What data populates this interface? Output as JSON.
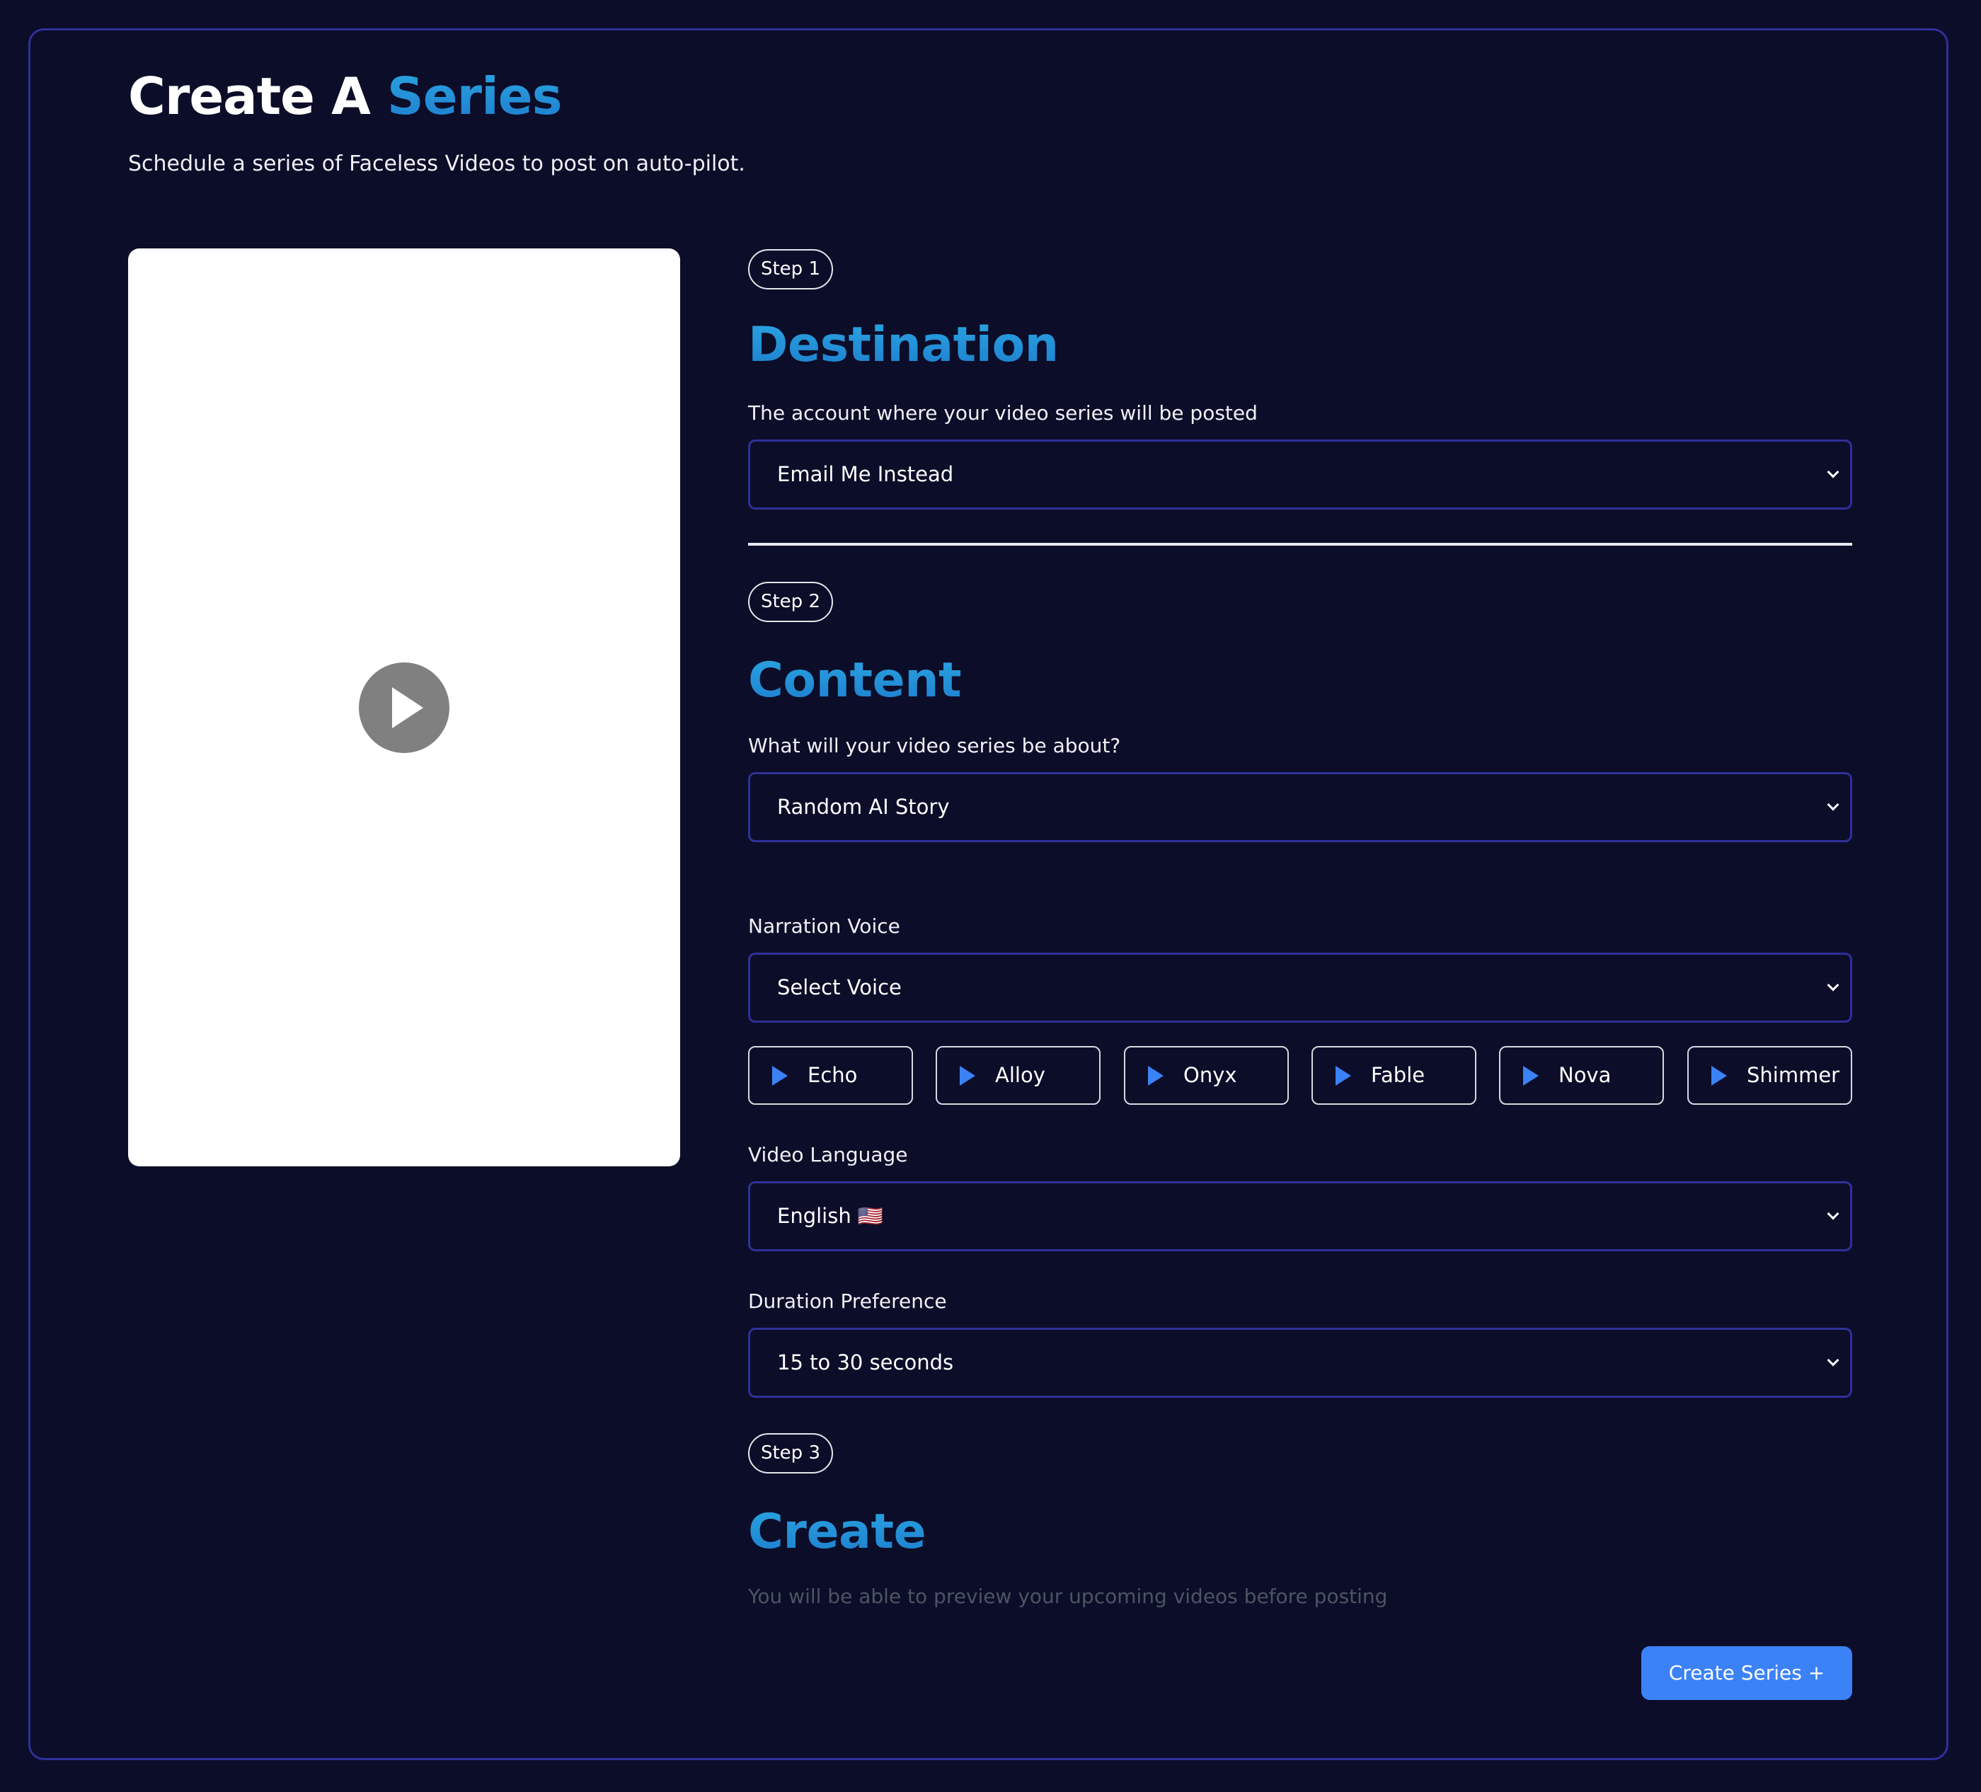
{
  "header": {
    "title_prefix": "Create A ",
    "title_highlight": "Series",
    "subtitle": "Schedule a series of Faceless Videos to post on auto-pilot."
  },
  "colors": {
    "background": "#0c0d29",
    "accent_border": "#30309a",
    "heading_gradient_start": "#2aa6e2",
    "heading_gradient_end": "#1e7ccd",
    "primary_button": "#3b82f6",
    "muted_text": "#4b5563",
    "play_button": "#808080"
  },
  "preview": {
    "play_icon": "play-icon"
  },
  "step1": {
    "badge": "Step 1",
    "heading": "Destination",
    "label": "The account where your video series will be posted",
    "select_value": "Email Me Instead"
  },
  "step2": {
    "badge": "Step 2",
    "heading": "Content",
    "content_label": "What will your video series be about?",
    "content_value": "Random AI Story",
    "voice_label": "Narration Voice",
    "voice_value": "Select Voice",
    "voices": [
      {
        "name": "Echo",
        "icon": "play-icon"
      },
      {
        "name": "Alloy",
        "icon": "play-icon"
      },
      {
        "name": "Onyx",
        "icon": "play-icon"
      },
      {
        "name": "Fable",
        "icon": "play-icon"
      },
      {
        "name": "Nova",
        "icon": "play-icon"
      },
      {
        "name": "Shimmer",
        "icon": "play-icon"
      }
    ],
    "language_label": "Video Language",
    "language_value": "English 🇺🇸",
    "duration_label": "Duration Preference",
    "duration_value": "15 to 30 seconds"
  },
  "step3": {
    "badge": "Step 3",
    "heading": "Create",
    "note": "You will be able to preview your upcoming videos before posting",
    "button_label": "Create Series +"
  }
}
